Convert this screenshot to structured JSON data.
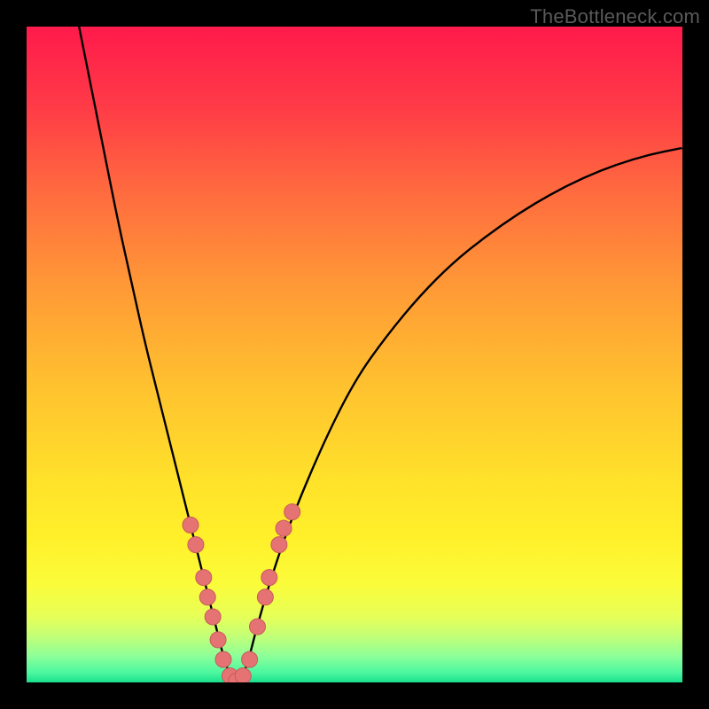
{
  "watermark": "TheBottleneck.com",
  "colors": {
    "frame_border": "#000000",
    "curve": "#000000",
    "dot_fill": "#e57373",
    "dot_stroke": "#c85a5a",
    "grad_stops": [
      {
        "offset": 0.0,
        "color": "#ff1a4b"
      },
      {
        "offset": 0.12,
        "color": "#ff3a47"
      },
      {
        "offset": 0.25,
        "color": "#ff6a3f"
      },
      {
        "offset": 0.4,
        "color": "#ff9a36"
      },
      {
        "offset": 0.55,
        "color": "#ffc22f"
      },
      {
        "offset": 0.7,
        "color": "#ffe32a"
      },
      {
        "offset": 0.78,
        "color": "#fff02a"
      },
      {
        "offset": 0.85,
        "color": "#fbfc3a"
      },
      {
        "offset": 0.9,
        "color": "#e6ff58"
      },
      {
        "offset": 0.93,
        "color": "#c2ff78"
      },
      {
        "offset": 0.96,
        "color": "#8cff98"
      },
      {
        "offset": 0.985,
        "color": "#4cf7a0"
      },
      {
        "offset": 1.0,
        "color": "#19e08c"
      }
    ]
  },
  "chart_data": {
    "type": "line",
    "title": "",
    "xlabel": "",
    "ylabel": "",
    "xlim": [
      0,
      100
    ],
    "ylim": [
      0,
      100
    ],
    "grid": false,
    "series": [
      {
        "name": "bottleneck-curve",
        "x": [
          8,
          10,
          12,
          14,
          16,
          18,
          20,
          22,
          24,
          26,
          27,
          28,
          29,
          30,
          31,
          32,
          33,
          34,
          35,
          37,
          40,
          45,
          50,
          55,
          60,
          65,
          70,
          75,
          80,
          85,
          90,
          95,
          100
        ],
        "y": [
          100,
          90,
          80,
          70,
          61,
          52,
          44,
          36,
          28,
          20,
          16,
          12,
          8,
          4,
          1,
          0,
          1,
          4,
          8,
          15,
          24,
          36,
          46,
          53,
          59,
          64,
          68,
          71.5,
          74.5,
          77,
          79,
          80.5,
          81.5
        ]
      }
    ],
    "highlight_dots": {
      "name": "sample-points",
      "x": [
        25.0,
        25.8,
        27.0,
        27.6,
        28.4,
        29.2,
        30.0,
        31.0,
        32.0,
        33.0,
        34.0,
        35.2,
        36.4,
        37.0,
        38.5,
        39.2,
        40.5
      ],
      "y": [
        24.0,
        21.0,
        16.0,
        13.0,
        10.0,
        6.5,
        3.5,
        1.0,
        0.2,
        1.0,
        3.5,
        8.5,
        13.0,
        16.0,
        21.0,
        23.5,
        26.0
      ]
    }
  }
}
